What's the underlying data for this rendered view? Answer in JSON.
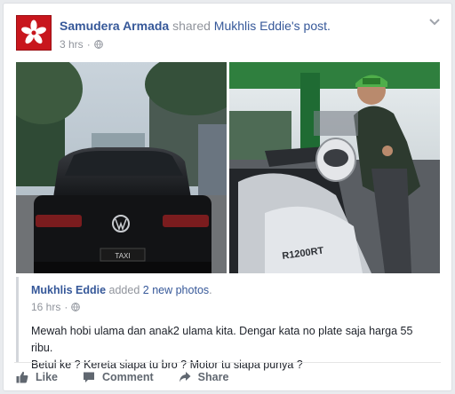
{
  "post": {
    "author": "Samudera Armada",
    "verb": "shared",
    "shared_from": "Mukhlis Eddie",
    "shared_suffix": "'s",
    "shared_object": "post.",
    "timestamp": "3 hrs",
    "separator": "·",
    "avatar_icon": "flower-logo-icon",
    "menu_icon": "chevron-down-icon"
  },
  "shared_post": {
    "author": "Mukhlis Eddie",
    "action_prefix": "added",
    "action_link": "2 new photos",
    "action_suffix": ".",
    "timestamp": "16 hrs",
    "separator": "·",
    "text_line1": "Mewah hobi ulama dan anak2 ulama kita. Dengar kata no plate saja harga 55 ribu.",
    "text_line2": "Betul ke ? Kereta siapa tu bro ? Motor tu siapa punya ?"
  },
  "photo_right": {
    "motorcycle_model_text": "R1200RT"
  },
  "photo_left": {
    "plate_text": "TAXI"
  },
  "actions": {
    "like_label": "Like",
    "comment_label": "Comment",
    "share_label": "Share"
  },
  "colors": {
    "link": "#365899",
    "muted": "#90949c",
    "avatar_bg": "#c8161d",
    "action_text": "#606770"
  }
}
